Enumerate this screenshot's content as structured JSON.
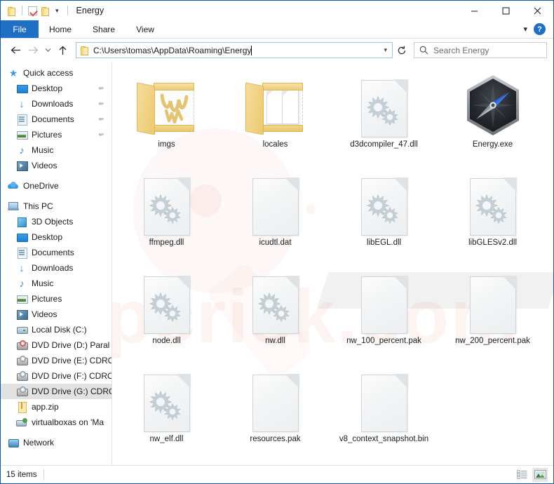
{
  "window": {
    "title": "Energy",
    "quick_access_toolbar": [
      {
        "name": "folder-icon",
        "label": "Folder"
      },
      {
        "name": "properties-icon",
        "label": "Properties"
      },
      {
        "name": "new-folder-icon",
        "label": "New folder"
      },
      {
        "name": "chevron-down-icon",
        "label": "Customize Quick Access Toolbar"
      }
    ],
    "controls": {
      "minimize": "Minimize",
      "maximize": "Maximize",
      "close": "Close"
    }
  },
  "ribbon": {
    "tabs": [
      {
        "label": "File",
        "active": true
      },
      {
        "label": "Home",
        "active": false
      },
      {
        "label": "Share",
        "active": false
      },
      {
        "label": "View",
        "active": false
      }
    ],
    "collapse_label": "Minimize the Ribbon",
    "help_label": "?"
  },
  "addressbar": {
    "back_label": "Back",
    "forward_label": "Forward",
    "recent_label": "Recent locations",
    "up_label": "Up",
    "path": "C:\\Users\\tomas\\AppData\\Roaming\\Energy",
    "dropdown_label": "Previous locations",
    "refresh_label": "Refresh",
    "search_placeholder": "Search Energy"
  },
  "sidebar": {
    "groups": [
      {
        "header": {
          "label": "Quick access",
          "icon": "star-icon"
        },
        "items": [
          {
            "label": "Desktop",
            "icon": "desktop-icon",
            "pinned": true
          },
          {
            "label": "Downloads",
            "icon": "downloads-icon",
            "pinned": true
          },
          {
            "label": "Documents",
            "icon": "documents-icon",
            "pinned": true
          },
          {
            "label": "Pictures",
            "icon": "pictures-icon",
            "pinned": true
          },
          {
            "label": "Music",
            "icon": "music-icon",
            "pinned": false
          },
          {
            "label": "Videos",
            "icon": "videos-icon",
            "pinned": false
          }
        ]
      },
      {
        "header": {
          "label": "OneDrive",
          "icon": "onedrive-icon"
        },
        "items": []
      },
      {
        "header": {
          "label": "This PC",
          "icon": "this-pc-icon"
        },
        "items": [
          {
            "label": "3D Objects",
            "icon": "3d-objects-icon",
            "pinned": false
          },
          {
            "label": "Desktop",
            "icon": "desktop-icon",
            "pinned": false
          },
          {
            "label": "Documents",
            "icon": "documents-icon",
            "pinned": false
          },
          {
            "label": "Downloads",
            "icon": "downloads-icon",
            "pinned": false
          },
          {
            "label": "Music",
            "icon": "music-icon",
            "pinned": false
          },
          {
            "label": "Pictures",
            "icon": "pictures-icon",
            "pinned": false
          },
          {
            "label": "Videos",
            "icon": "videos-icon",
            "pinned": false
          },
          {
            "label": "Local Disk (C:)",
            "icon": "local-disk-icon",
            "pinned": false
          },
          {
            "label": "DVD Drive (D:) Paral",
            "icon": "dvd-drive-parallels-icon",
            "pinned": false
          },
          {
            "label": "DVD Drive (E:) CDRO",
            "icon": "dvd-drive-icon",
            "pinned": false
          },
          {
            "label": "DVD Drive (F:) CDRO",
            "icon": "dvd-drive-icon",
            "pinned": false
          },
          {
            "label": "DVD Drive (G:) CDRO",
            "icon": "dvd-drive-icon",
            "pinned": false,
            "selected": true
          },
          {
            "label": "app.zip",
            "icon": "zip-icon",
            "pinned": false
          },
          {
            "label": "virtualboxas on 'Ma",
            "icon": "network-drive-icon",
            "pinned": false
          }
        ]
      },
      {
        "header": {
          "label": "Network",
          "icon": "network-icon"
        },
        "items": []
      }
    ]
  },
  "files": [
    {
      "name": "imgs",
      "type": "folder",
      "art": "squiggle"
    },
    {
      "name": "locales",
      "type": "folder",
      "art": "pages"
    },
    {
      "name": "d3dcompiler_47.dll",
      "type": "dll"
    },
    {
      "name": "Energy.exe",
      "type": "exe"
    },
    {
      "name": "ffmpeg.dll",
      "type": "dll"
    },
    {
      "name": "icudtl.dat",
      "type": "file"
    },
    {
      "name": "libEGL.dll",
      "type": "dll"
    },
    {
      "name": "libGLESv2.dll",
      "type": "dll"
    },
    {
      "name": "node.dll",
      "type": "dll"
    },
    {
      "name": "nw.dll",
      "type": "dll"
    },
    {
      "name": "nw_100_percent.pak",
      "type": "file"
    },
    {
      "name": "nw_200_percent.pak",
      "type": "file"
    },
    {
      "name": "nw_elf.dll",
      "type": "dll"
    },
    {
      "name": "resources.pak",
      "type": "file"
    },
    {
      "name": "v8_context_snapshot.bin",
      "type": "file"
    }
  ],
  "statusbar": {
    "item_count": "15 items",
    "view_details_label": "Details view",
    "view_large_icons_label": "Large icons view"
  },
  "watermark": {
    "text": "pcrisk.com"
  },
  "colors": {
    "accent": "#1f6fc4",
    "window_border": "#0a5aa8",
    "selection": "#e2e2e2",
    "folder": "#eccb72",
    "gear": "#c2cdd4"
  }
}
